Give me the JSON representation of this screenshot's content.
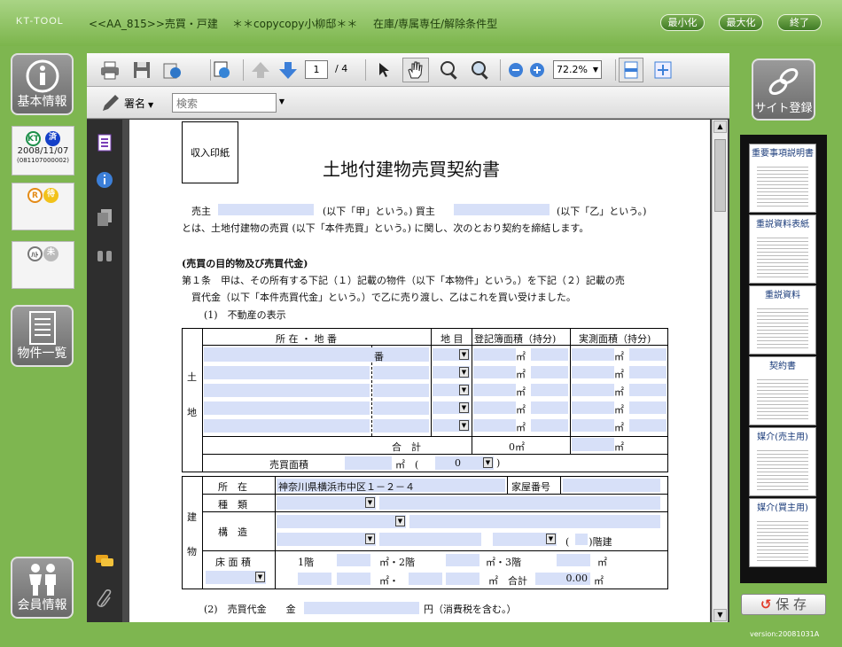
{
  "app": {
    "brand": "KT-TOOL",
    "record": "<<AA_815>>売買・戸建",
    "customer": "＊＊copycopy小柳邸＊＊",
    "status": "在庫/専属専任/解除条件型",
    "minimize": "最小化",
    "maximize": "最大化",
    "exit": "終了",
    "version": "version:20081031A"
  },
  "left": {
    "basic": "基本情報",
    "kt_date": "2008/11/07",
    "kt_id": "(081107000002)",
    "kt_label": "KT",
    "done": "済",
    "r_label": "R",
    "wait": "待",
    "ha_label": "ﾊﾄ",
    "not": "未",
    "list": "物件一覧",
    "member": "会員情報"
  },
  "right": {
    "site": "サイト登録",
    "save": "保 存",
    "thumbs": [
      "重要事項説明書",
      "重説資料表紙",
      "重説資料",
      "契約書",
      "媒介(売主用)",
      "媒介(買主用)"
    ]
  },
  "toolbar": {
    "page": "1",
    "total": "/ 4",
    "zoom": "72.2%",
    "sign": "署名",
    "search_placeholder": "検索"
  },
  "doc": {
    "stamp": "収入印紙",
    "title": "土地付建物売買契約書",
    "seller": "売主",
    "kou": "(以下「甲」という。) 買主",
    "otsu": "(以下「乙」という。)",
    "line2": "とは、土地付建物の売買 (以下「本件売買」という。) に関し、次のとおり契約を締結します。",
    "heading": "(売買の目的物及び売買代金)",
    "art1a": "第１条　甲は、その所有する下記（１）記載の物件（以下「本物件」という。）を下記（２）記載の売",
    "art1b": "買代金（以下「本件売買代金」という。）で乙に売り渡し、乙はこれを買い受けました。",
    "item1": "(1)　不動産の表示",
    "h_loc": "所 在 ・ 地 番",
    "h_cat": "地 目",
    "h_reg": "登記簿面積（持分)",
    "h_act": "実測面積（持分)",
    "land1": "土",
    "land2": "地",
    "ban": "番",
    "sqm": "㎡",
    "total": "合　計",
    "total_val": "0㎡",
    "sale_area": "売買面積",
    "sale_sqm": "㎡　(",
    "sale_zero": "0",
    "sale_close": ")",
    "bld1": "建",
    "bld2": "物",
    "b_loc": "所　在",
    "b_addr": "神奈川県横浜市中区１－２－４",
    "b_no": "家屋番号",
    "b_kind": "種　類",
    "b_struct": "構　造",
    "floors": "(　　)階建",
    "b_floor": "床 面 積",
    "f1": "1階",
    "f2": "㎡・2階",
    "f3": "㎡・3階",
    "dot": "㎡・",
    "sum": "合計",
    "sum_val": "0.00",
    "item2": "(2)　売買代金　　金",
    "price_suffix": "円（消費税を含む。）"
  },
  "colors": {
    "frame": "#7eb650",
    "field": "#d7e0f8"
  }
}
